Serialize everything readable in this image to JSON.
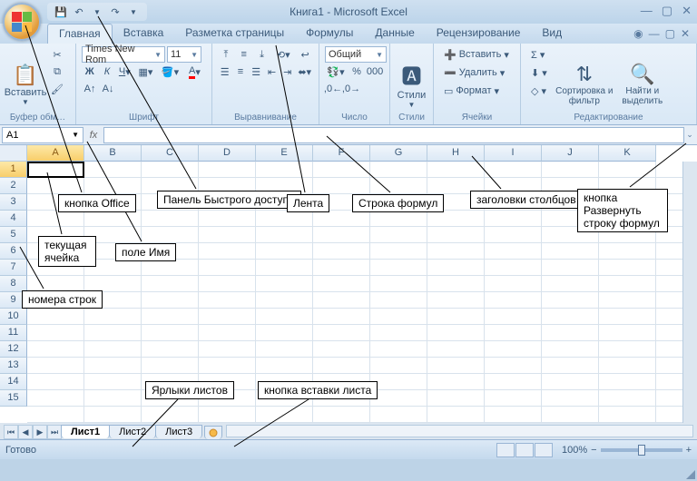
{
  "title": "Книга1 - Microsoft Excel",
  "qat": {
    "save": "💾",
    "undo": "↶",
    "redo": "↷"
  },
  "tabs": {
    "home": "Главная",
    "insert": "Вставка",
    "layout": "Разметка страницы",
    "formulas": "Формулы",
    "data": "Данные",
    "review": "Рецензирование",
    "view": "Вид"
  },
  "ribbon": {
    "paste": "Вставить",
    "clipboard": "Буфер обм…",
    "font": "Шрифт",
    "align": "Выравнивание",
    "number": "Число",
    "styles": "Стили",
    "cells": "Ячейки",
    "editing": "Редактирование",
    "fontname": "Times New Rom",
    "fontsize": "11",
    "numfmt": "Общий",
    "insert": "Вставить",
    "delete": "Удалить",
    "format": "Формат",
    "sort": "Сортировка и фильтр",
    "find": "Найти и выделить"
  },
  "nameBox": "A1",
  "cols": [
    "A",
    "B",
    "C",
    "D",
    "E",
    "F",
    "G",
    "H",
    "I",
    "J",
    "K"
  ],
  "rows": [
    "1",
    "2",
    "3",
    "4",
    "5",
    "6",
    "7",
    "8",
    "9",
    "10",
    "11",
    "12",
    "13",
    "14",
    "15"
  ],
  "sheets": {
    "s1": "Лист1",
    "s2": "Лист2",
    "s3": "Лист3"
  },
  "status": "Готово",
  "zoom": "100%",
  "callouts": {
    "office": "кнопка Office",
    "qat": "Панель Быстрого доступа",
    "ribbon": "Лента",
    "formula": "Строка формул",
    "colhead": "заголовки столбцов",
    "expand": "кнопка Развернуть строку формул",
    "curcell": "текущая ячейка",
    "namebox": "поле Имя",
    "rownum": "номера строк",
    "tabs": "Ярлыки листов",
    "instab": "кнопка вставки листа"
  }
}
